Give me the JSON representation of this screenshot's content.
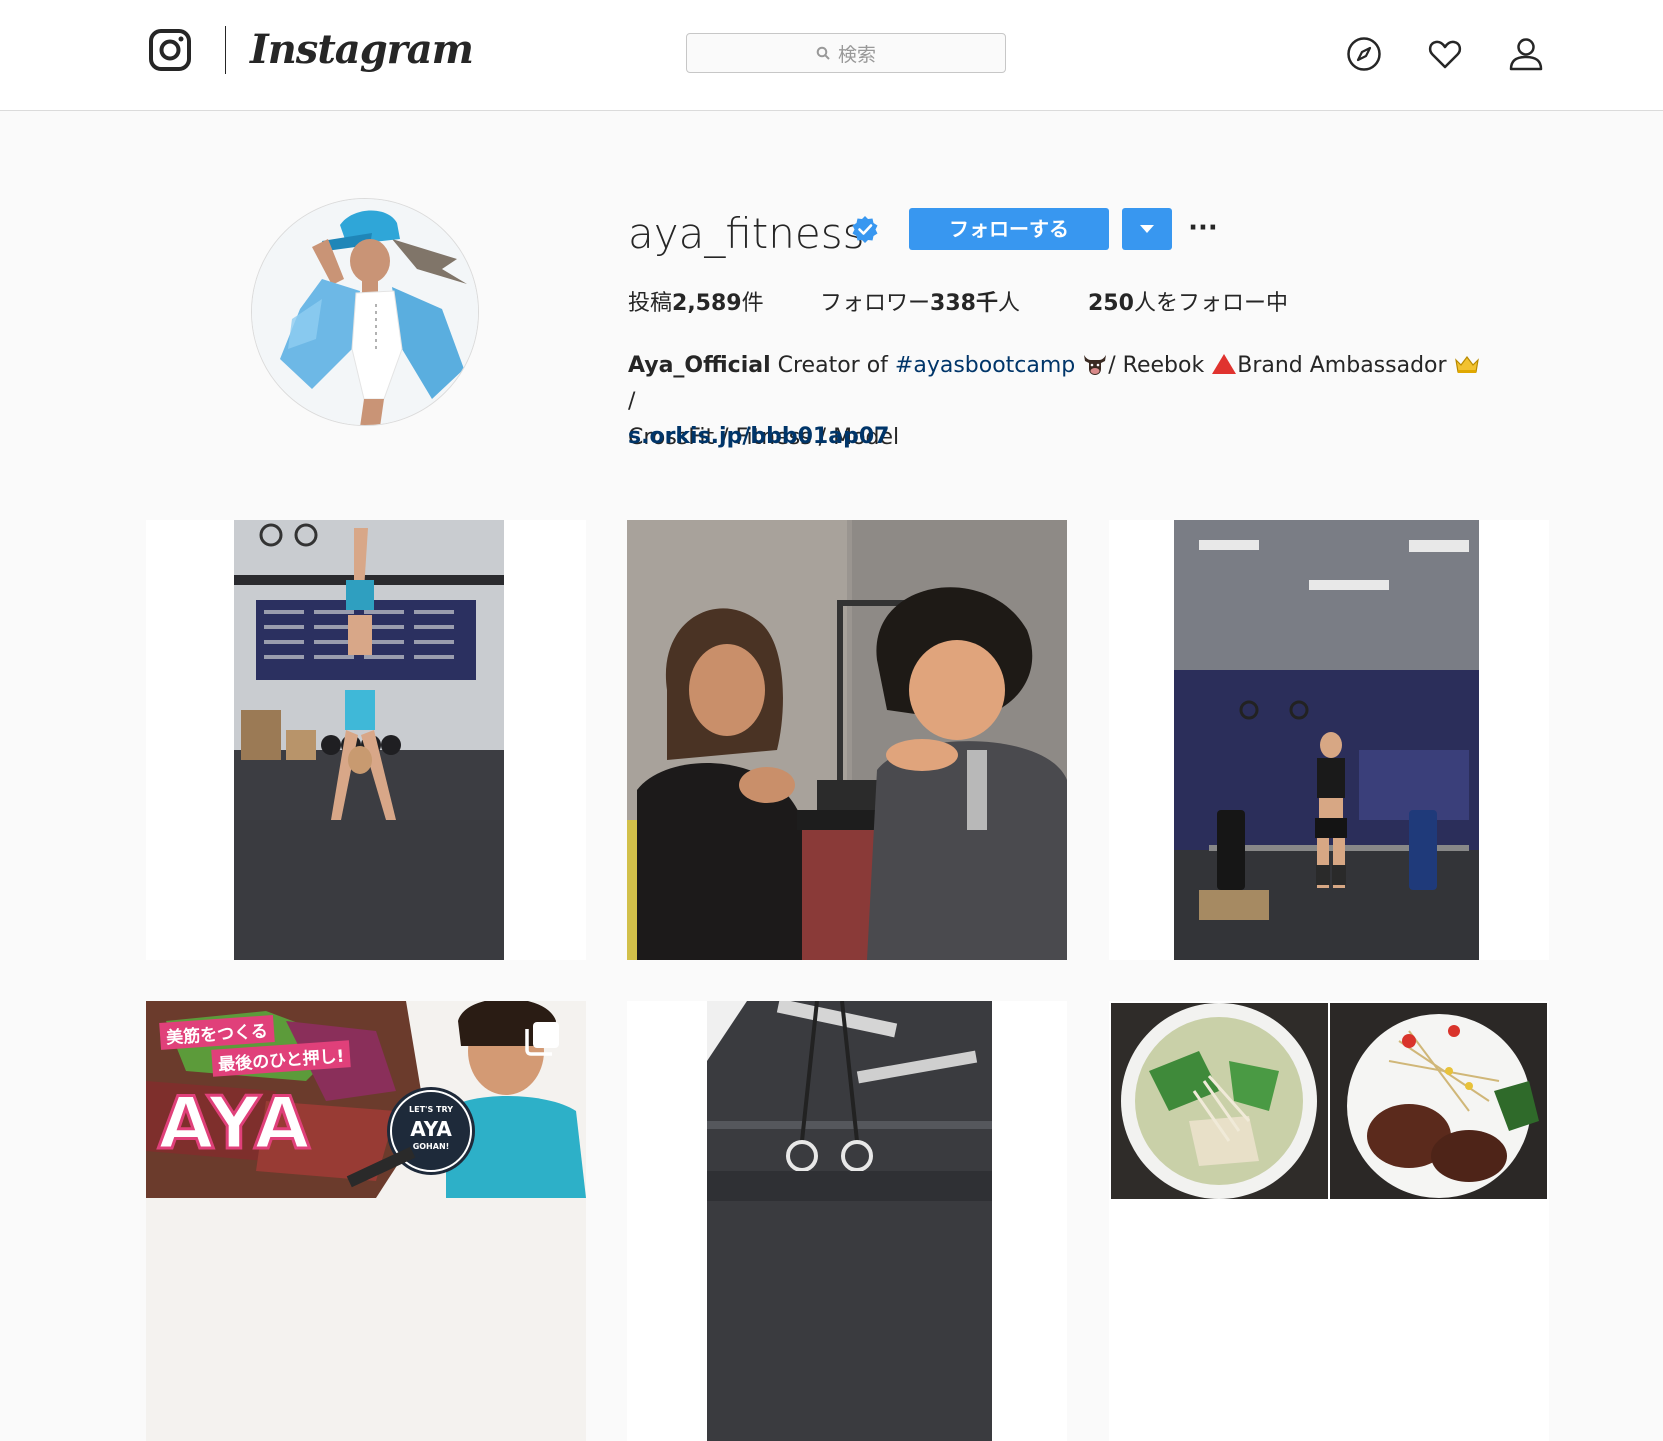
{
  "header": {
    "logo_text": "Instagram",
    "search_placeholder": "検索",
    "icons": [
      "instagram-camera-icon",
      "search-icon",
      "explore-compass-icon",
      "heart-icon",
      "profile-user-icon"
    ]
  },
  "profile": {
    "username": "aya_fitness",
    "verified": true,
    "follow_label": "フォローする",
    "stats": {
      "posts_prefix": "投稿",
      "posts_count": "2,589",
      "posts_suffix": "件",
      "followers_prefix": "フォロワー",
      "followers_count": "338千",
      "followers_suffix": "人",
      "following_count": "250",
      "following_suffix": "人をフォロー中"
    },
    "bio": {
      "name": "Aya_Official",
      "text1": " Creator of ",
      "hashtag": "#ayasbootcamp",
      "text2": "/ Reebok",
      "text3": "Brand Ambassador ",
      "text4": " /",
      "line2": "CrossFit / Fitness / Model",
      "link": "s.orkis.jp/bbb01ap07"
    }
  },
  "posts": [
    {
      "kind": "video",
      "desc": "handstand-walk-gym"
    },
    {
      "kind": "photo",
      "desc": "two-people-radio-studio"
    },
    {
      "kind": "video",
      "desc": "deadlift-gym"
    },
    {
      "kind": "carousel",
      "desc": "magazine-cover",
      "overlay_line1": "美筋をつくる",
      "overlay_line2": "最後のひと押し!",
      "overlay_big": "AYA",
      "badge_small": "LET'S TRY",
      "badge_big": "AYA",
      "badge_sub": "GOHAN!"
    },
    {
      "kind": "video",
      "desc": "gym-ceiling-rings"
    },
    {
      "kind": "photo",
      "desc": "soup-and-steak-dinner"
    }
  ],
  "colors": {
    "accent": "#3897f0",
    "link": "#003569",
    "verified": "#3897f0"
  }
}
